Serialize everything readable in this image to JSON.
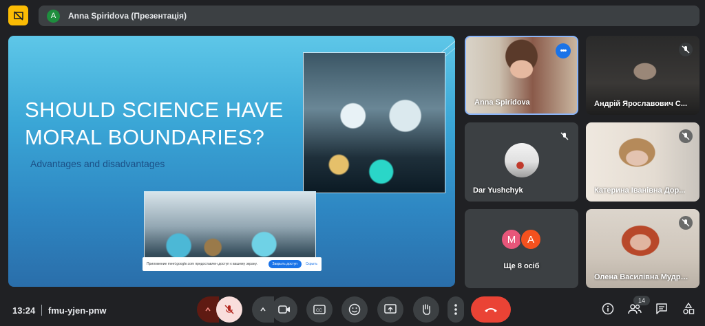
{
  "header": {
    "presenter_initial": "A",
    "presenter_title": "Anna Spiridova (Презентація)"
  },
  "slide": {
    "title_line1": "SHOULD SCIENCE HAVE",
    "title_line2": "MORAL BOUNDARIES?",
    "subtitle": "Advantages and disadvantages",
    "share_banner": {
      "text": "Приложение meet.google.com предоставлен доступ к вашему экрану.",
      "button": "Закрыть доступ",
      "hide": "Скрыть"
    }
  },
  "participants": [
    {
      "name": "Anna Spiridova"
    },
    {
      "name": "Андрій Ярославович С..."
    },
    {
      "name": "Dar Yushchyk"
    },
    {
      "name": "Катерина Іванівна Дор..."
    },
    {
      "name": "Олена Василівна Мудра..."
    }
  ],
  "more_tile": {
    "initials": [
      "M",
      "A"
    ],
    "label": "Ще 8 осіб"
  },
  "bottombar": {
    "time": "13:24",
    "meeting_code": "fmu-yjen-pnw",
    "participant_count": "14"
  },
  "colors": {
    "accent": "#8ab4f8",
    "hangup": "#ea4335",
    "brand_yellow": "#fbbc04",
    "avatar_m": "#e8567a",
    "avatar_a": "#f4511e"
  }
}
